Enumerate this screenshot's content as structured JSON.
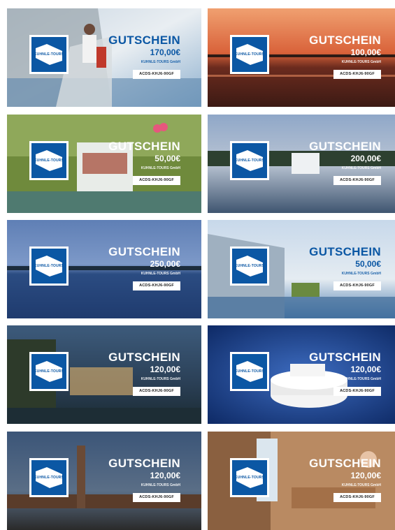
{
  "logo": {
    "text": "KUHNLE-TOURS"
  },
  "vouchers": [
    {
      "title": "GUTSCHEIN",
      "amount": "170,00€",
      "company": "KUHNLE-TOURS GmbH",
      "code": "ACDS-KHJ6-90GF",
      "text_color": "#0b57a4"
    },
    {
      "title": "GUTSCHEIN",
      "amount": "100,00€",
      "company": "KUHNLE-TOURS GmbH",
      "code": "ACDS-KHJ6-90GF",
      "text_color": "#ffffff"
    },
    {
      "title": "GUTSCHEIN",
      "amount": "50,00€",
      "company": "KUHNLE-TOURS GmbH",
      "code": "ACDS-KHJ6-90GF",
      "text_color": "#ffffff"
    },
    {
      "title": "GUTSCHEIN",
      "amount": "200,00€",
      "company": "KUHNLE-TOURS GmbH",
      "code": "ACDS-KHJ6-90GF",
      "text_color": "#ffffff"
    },
    {
      "title": "GUTSCHEIN",
      "amount": "250,00€",
      "company": "KUHNLE-TOURS GmbH",
      "code": "ACDS-KHJ6-90GF",
      "text_color": "#ffffff"
    },
    {
      "title": "GUTSCHEIN",
      "amount": "50,00€",
      "company": "KUHNLE-TOURS GmbH",
      "code": "ACDS-KHJ6-90GF",
      "text_color": "#0b57a4"
    },
    {
      "title": "GUTSCHEIN",
      "amount": "120,00€",
      "company": "KUHNLE-TOURS GmbH",
      "code": "ACDS-KHJ6-90GF",
      "text_color": "#ffffff"
    },
    {
      "title": "GUTSCHEIN",
      "amount": "120,00€",
      "company": "KUHNLE-TOURS GmbH",
      "code": "ACDS-KHJ6-90GF",
      "text_color": "#ffffff"
    },
    {
      "title": "GUTSCHEIN",
      "amount": "120,00€",
      "company": "KUHNLE-TOURS GmbH",
      "code": "ACDS-KHJ6-90GF",
      "text_color": "#ffffff"
    },
    {
      "title": "GUTSCHEIN",
      "amount": "120,00€",
      "company": "KUHNLE-TOURS GmbH",
      "code": "ACDS-KHJ6-90GF",
      "text_color": "#ffffff"
    }
  ]
}
